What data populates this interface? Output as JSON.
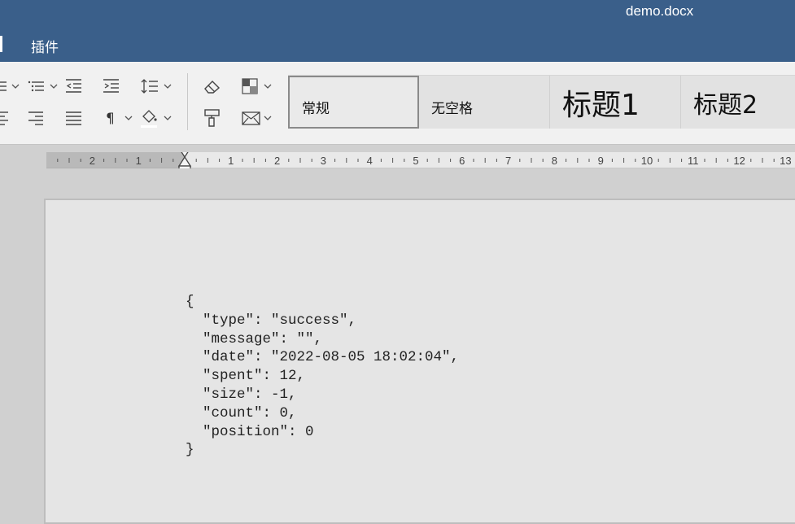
{
  "window": {
    "title": "demo.docx"
  },
  "tabs": {
    "plugins": "插件"
  },
  "styles_gallery": [
    {
      "label": "常规",
      "selected": true
    },
    {
      "label": "无空格",
      "selected": false
    },
    {
      "label": "标题1",
      "selected": false
    },
    {
      "label": "标题2",
      "selected": false
    }
  ],
  "ruler": {
    "left_numbers": [
      "2",
      "1"
    ],
    "right_numbers": [
      "1",
      "2",
      "3",
      "4",
      "5",
      "6",
      "7",
      "8",
      "9",
      "10",
      "11",
      "12",
      "13"
    ]
  },
  "document": {
    "lines": [
      "{",
      "  \"type\": \"success\",",
      "  \"message\": \"\",",
      "  \"date\": \"2022-08-05 18:02:04\",",
      "  \"spent\": 12,",
      "  \"size\": -1,",
      "  \"count\": 0,",
      "  \"position\": 0",
      "}"
    ]
  },
  "toolbar": {
    "icons": [
      "bullet-list-icon",
      "multilevel-list-icon",
      "decrease-indent-icon",
      "increase-indent-icon",
      "line-spacing-icon",
      "align-center-icon",
      "align-right-icon",
      "justify-icon",
      "paragraph-mark-icon",
      "shading-icon",
      "eraser-icon",
      "format-painter-icon",
      "table-icon",
      "mail-merge-icon"
    ]
  }
}
